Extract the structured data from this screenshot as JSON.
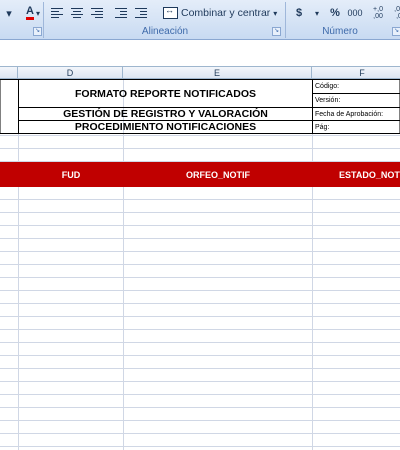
{
  "ribbon": {
    "font_color_label": "A",
    "merge_label": "Combinar y centrar",
    "currency_label": "$",
    "percent_label": "%",
    "thousands_label": "000",
    "increase_decimal_label": "+,0 ,00",
    "decrease_decimal_label": ",00 ,0",
    "groups": {
      "alineacion": "Alineación",
      "numero": "Número"
    }
  },
  "columns": {
    "d": "D",
    "e": "E",
    "f": "F"
  },
  "header_block": {
    "title": "FORMATO REPORTE NOTIFICADOS",
    "subtitle": "GESTIÓN DE REGISTRO Y VALORACIÓN",
    "procedure": "PROCEDIMIENTO NOTIFICACIONES",
    "meta": {
      "codigo": "Código:",
      "version": "Versión:",
      "fecha": "Fecha de Aprobación:",
      "pag": "Pág:"
    }
  },
  "table_headers": {
    "fud": "FUD",
    "orfeo": "ORFEO_NOTIF",
    "estado": "ESTADO_NOTIF"
  },
  "colors": {
    "header_band": "#c00000",
    "ribbon": "#d5e3f5",
    "gridline": "#d0d7e5"
  }
}
